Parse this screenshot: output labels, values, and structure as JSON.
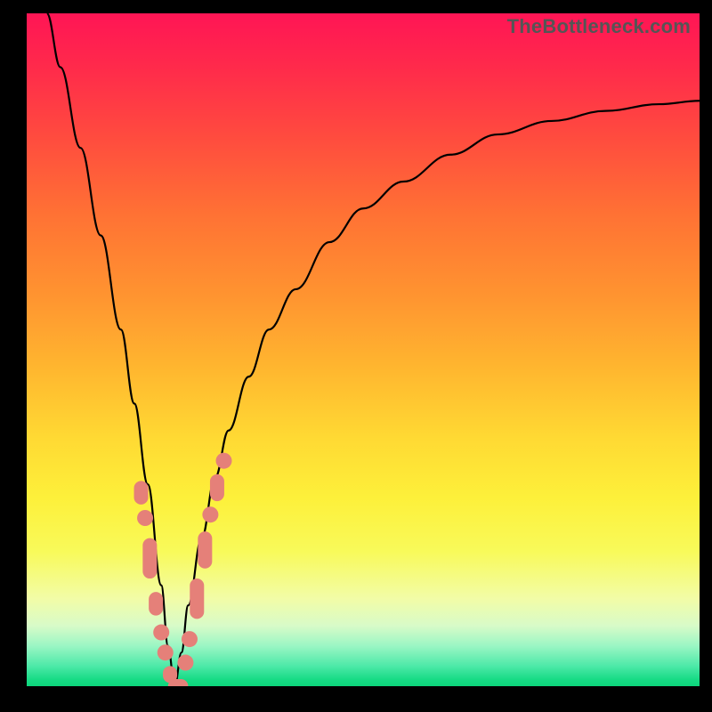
{
  "watermark": "TheBottleneck.com",
  "colors": {
    "frame": "#000000",
    "curve": "#000000",
    "marker": "#e58079"
  },
  "chart_data": {
    "type": "line",
    "title": "",
    "xlabel": "",
    "ylabel": "",
    "xlim": [
      0,
      100
    ],
    "ylim": [
      0,
      100
    ],
    "grid": false,
    "legend": false,
    "description": "V-shaped bottleneck curve over a vertical red-to-green gradient. The curve starts near the top-left, descends steeply to a minimum near x≈22 at the bottom (green zone), then rises and levels off toward the upper-right. Salmon capsule/round markers are clustered along both arms of the V near the bottom.",
    "series": [
      {
        "name": "bottleneck_curve",
        "x": [
          3,
          5,
          8,
          11,
          14,
          16,
          18,
          20,
          21,
          22,
          23,
          24,
          26,
          28,
          30,
          33,
          36,
          40,
          45,
          50,
          56,
          63,
          70,
          78,
          86,
          94,
          100
        ],
        "y": [
          100,
          92,
          80,
          67,
          53,
          42,
          30,
          15,
          6,
          0,
          5,
          12,
          22,
          31,
          38,
          46,
          53,
          59,
          66,
          71,
          75,
          79,
          82,
          84,
          85.5,
          86.5,
          87
        ]
      }
    ],
    "markers": [
      {
        "shape": "capsule",
        "x": 17.0,
        "y_top": 30.5,
        "y_bot": 27.0
      },
      {
        "shape": "round",
        "x": 17.6,
        "y": 25.0
      },
      {
        "shape": "capsule",
        "x": 18.3,
        "y_top": 22.0,
        "y_bot": 16.0
      },
      {
        "shape": "capsule",
        "x": 19.2,
        "y_top": 14.0,
        "y_bot": 10.5
      },
      {
        "shape": "round",
        "x": 20.0,
        "y": 8.0
      },
      {
        "shape": "round",
        "x": 20.6,
        "y": 5.0
      },
      {
        "shape": "capsule",
        "x": 21.3,
        "y_top": 3.0,
        "y_bot": 0.5
      },
      {
        "shape": "capsule_h",
        "x_left": 21.0,
        "x_right": 24.0,
        "y": 0.0
      },
      {
        "shape": "round",
        "x": 23.6,
        "y": 3.5
      },
      {
        "shape": "round",
        "x": 24.2,
        "y": 7.0
      },
      {
        "shape": "capsule",
        "x": 25.3,
        "y_top": 16.0,
        "y_bot": 10.0
      },
      {
        "shape": "capsule",
        "x": 26.5,
        "y_top": 23.0,
        "y_bot": 17.5
      },
      {
        "shape": "round",
        "x": 27.3,
        "y": 25.5
      },
      {
        "shape": "capsule",
        "x": 28.3,
        "y_top": 31.5,
        "y_bot": 27.5
      },
      {
        "shape": "round",
        "x": 29.3,
        "y": 33.5
      }
    ]
  }
}
